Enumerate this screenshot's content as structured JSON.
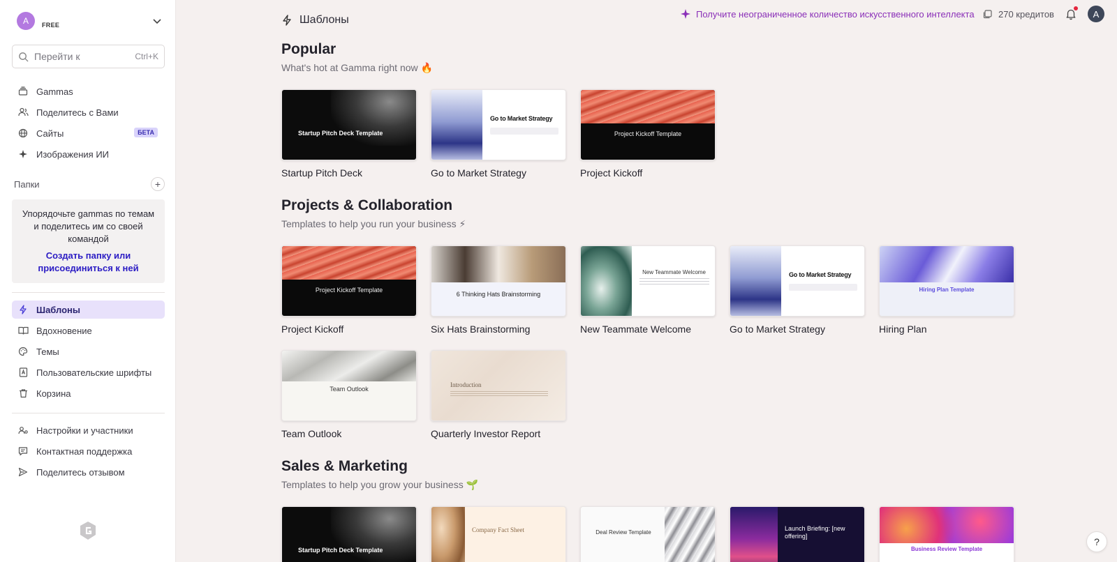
{
  "workspace": {
    "avatar_letter": "A",
    "plan": "FREE"
  },
  "search": {
    "placeholder": "Перейти к",
    "shortcut": "Ctrl+K"
  },
  "sidebar": {
    "top_items": [
      {
        "label": "Gammas",
        "icon": "stack-icon"
      },
      {
        "label": "Поделитесь с Вами",
        "icon": "users-icon"
      },
      {
        "label": "Сайты",
        "icon": "globe-icon",
        "badge": "БЕТА"
      },
      {
        "label": "Изображения ИИ",
        "icon": "sparkle-icon"
      }
    ],
    "folders_heading": "Папки",
    "folders_hint": "Упорядочьте gammas по темам и поделитесь им со своей командой",
    "folders_link": "Создать папку или присоединиться к ней",
    "mid_items": [
      {
        "label": "Шаблоны",
        "icon": "lightning-icon",
        "active": true
      },
      {
        "label": "Вдохновение",
        "icon": "book-icon"
      },
      {
        "label": "Темы",
        "icon": "palette-icon"
      },
      {
        "label": "Пользовательские шрифты",
        "icon": "font-icon"
      },
      {
        "label": "Корзина",
        "icon": "trash-icon"
      }
    ],
    "bottom_items": [
      {
        "label": "Настройки и участники",
        "icon": "settings-icon"
      },
      {
        "label": "Контактная поддержка",
        "icon": "chat-icon"
      },
      {
        "label": "Поделитесь отзывом",
        "icon": "send-icon"
      }
    ]
  },
  "header": {
    "title": "Шаблоны",
    "promo": "Получите неограниченное количество искусственного интеллекта",
    "credits": "270 кредитов",
    "user_avatar": "A"
  },
  "sections": [
    {
      "title": "Popular",
      "subtitle": "What's hot at Gamma right now 🔥",
      "cards": [
        {
          "caption": "Startup Pitch Deck",
          "style": "dark",
          "thumb_title": "Startup Pitch Deck Template"
        },
        {
          "caption": "Go to Market Strategy",
          "style": "gtm",
          "thumb_title": "Go to Market Strategy"
        },
        {
          "caption": "Project Kickoff",
          "style": "coral",
          "thumb_title": "Project Kickoff Template"
        }
      ]
    },
    {
      "title": "Projects & Collaboration",
      "subtitle": "Templates to help you run your business ⚡",
      "cards": [
        {
          "caption": "Project Kickoff",
          "style": "coral",
          "thumb_title": "Project Kickoff Template"
        },
        {
          "caption": "Six Hats Brainstorming",
          "style": "hats",
          "thumb_title": "6 Thinking Hats Brainstorming"
        },
        {
          "caption": "New Teammate Welcome",
          "style": "welcome",
          "thumb_title": "New Teammate Welcome"
        },
        {
          "caption": "Go to Market Strategy",
          "style": "gtm",
          "thumb_title": "Go to Market Strategy"
        },
        {
          "caption": "Hiring Plan",
          "style": "hiring",
          "thumb_title": "Hiring Plan Template"
        },
        {
          "caption": "Team Outlook",
          "style": "outlook",
          "thumb_title": "Team Outlook"
        },
        {
          "caption": "Quarterly Investor Report",
          "style": "investor",
          "thumb_title": "Introduction"
        }
      ]
    },
    {
      "title": "Sales & Marketing",
      "subtitle": "Templates to help you grow your business 🌱",
      "cards": [
        {
          "caption": "",
          "style": "dark",
          "thumb_title": "Startup Pitch Deck Template"
        },
        {
          "caption": "",
          "style": "fact",
          "thumb_title": "Company Fact Sheet"
        },
        {
          "caption": "",
          "style": "deal",
          "thumb_title": "Deal Review Template"
        },
        {
          "caption": "",
          "style": "launch",
          "thumb_title": "Launch Briefing: [new offering]"
        },
        {
          "caption": "",
          "style": "biz",
          "thumb_title": "Business Review Template"
        }
      ]
    }
  ],
  "help": "?",
  "colors": {
    "accent": "#4b3fd6",
    "promo": "#8a2fb8",
    "active_bg": "#e8e1fb"
  }
}
